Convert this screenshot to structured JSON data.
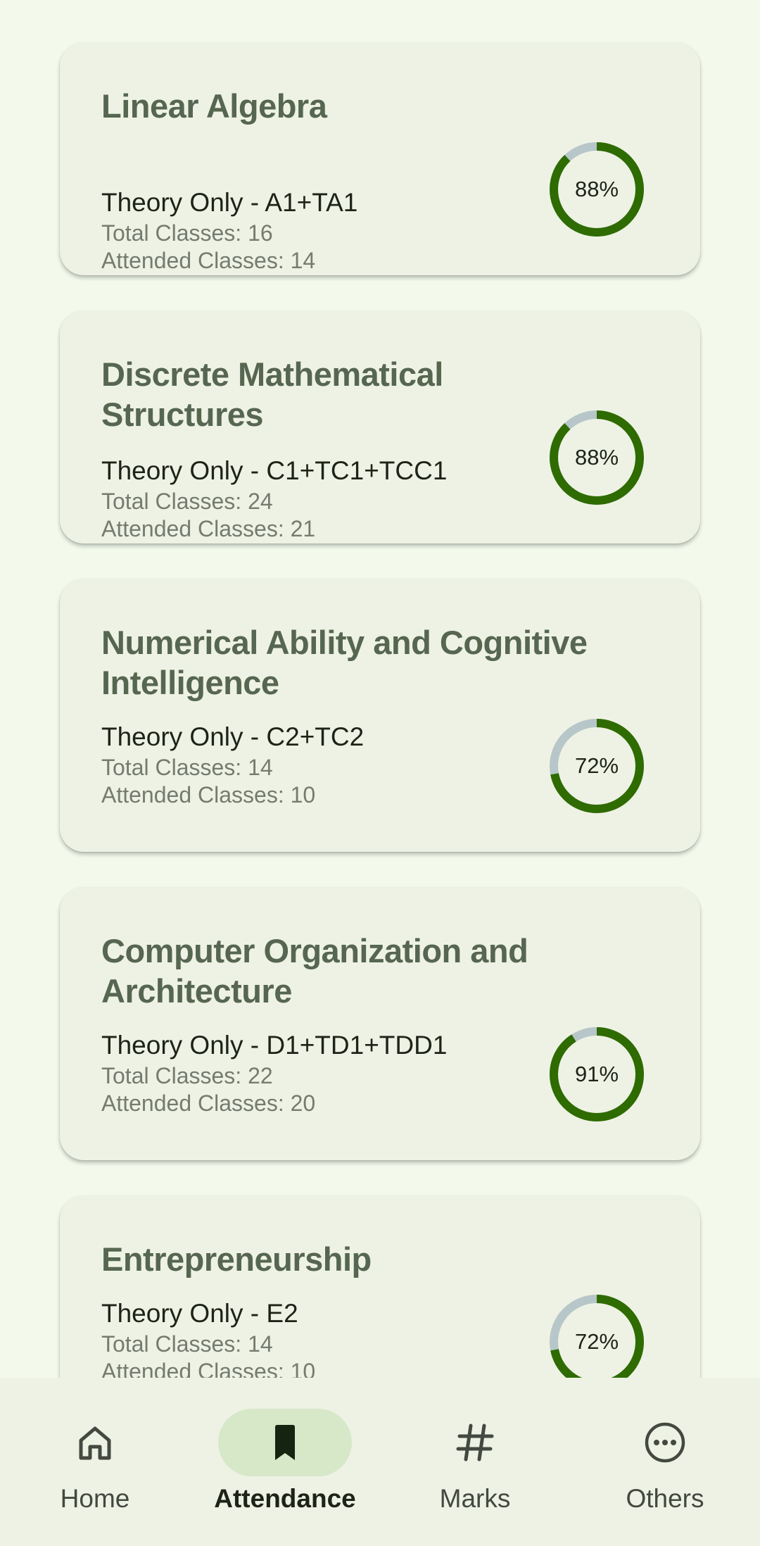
{
  "courses": [
    {
      "title": "Linear Algebra",
      "subtitle": "Theory Only - A1+TA1",
      "total": "Total Classes: 16",
      "attended": "Attended Classes: 14",
      "percent_label": "88%",
      "percent": 88
    },
    {
      "title": "Discrete Mathematical Structures",
      "subtitle": "Theory Only - C1+TC1+TCC1",
      "total": "Total Classes: 24",
      "attended": "Attended Classes: 21",
      "percent_label": "88%",
      "percent": 88
    },
    {
      "title": "Numerical Ability and Cognitive Intelligence",
      "subtitle": "Theory Only - C2+TC2",
      "total": "Total Classes: 14",
      "attended": "Attended Classes: 10",
      "percent_label": "72%",
      "percent": 72
    },
    {
      "title": "Computer Organization and Architecture",
      "subtitle": "Theory Only - D1+TD1+TDD1",
      "total": "Total Classes: 22",
      "attended": "Attended Classes: 20",
      "percent_label": "91%",
      "percent": 91
    },
    {
      "title": "Entrepreneurship",
      "subtitle": "Theory Only - E2",
      "total": "Total Classes: 14",
      "attended": "Attended Classes: 10",
      "percent_label": "72%",
      "percent": 72
    }
  ],
  "nav": {
    "items": [
      {
        "label": "Home",
        "icon": "home-icon",
        "active": false
      },
      {
        "label": "Attendance",
        "icon": "bookmark-icon",
        "active": true
      },
      {
        "label": "Marks",
        "icon": "hash-icon",
        "active": false
      },
      {
        "label": "Others",
        "icon": "more-horizontal-icon",
        "active": false
      }
    ]
  },
  "colors": {
    "background": "#f3faec",
    "card": "#eef2e4",
    "title": "#566650",
    "progress": "#2e6b00",
    "track": "#b7c6c9",
    "nav_active_pill": "#d6e8c8"
  }
}
